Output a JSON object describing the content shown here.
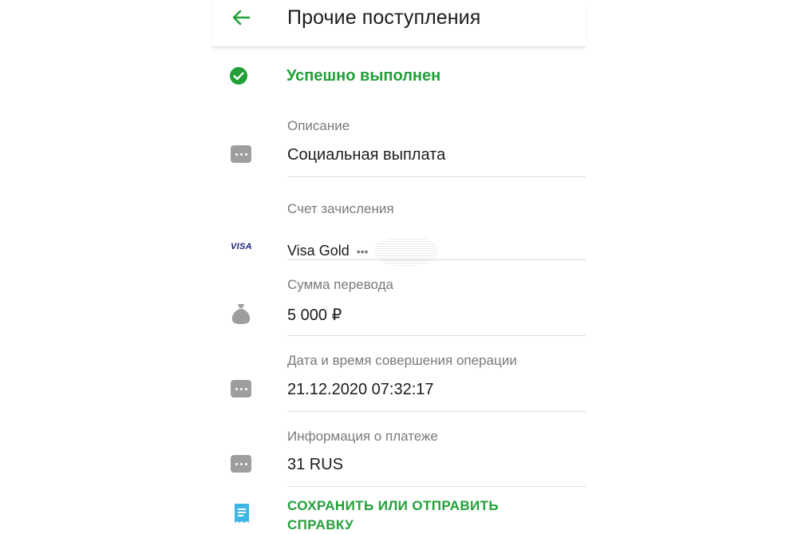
{
  "header": {
    "title": "Прочие поступления",
    "back_icon": "arrow-left-icon"
  },
  "status": {
    "text": "Успешно выполнен",
    "icon": "check-circle-icon",
    "color": "#21a038"
  },
  "details": {
    "description": {
      "label": "Описание",
      "value": "Социальная выплата",
      "icon": "dots-icon"
    },
    "account": {
      "label": "Счет зачисления",
      "value": "Visa Gold",
      "suffix": "•••",
      "icon_text": "VISA"
    },
    "amount": {
      "label": "Сумма перевода",
      "value": "5 000 ₽",
      "icon": "money-bag-icon"
    },
    "datetime": {
      "label": "Дата и время совершения операции",
      "value": "21.12.2020 07:32:17",
      "icon": "dots-icon"
    },
    "payment_info": {
      "label": "Информация о платеже",
      "value": "31 RUS",
      "icon": "dots-icon"
    }
  },
  "action": {
    "label": "СОХРАНИТЬ ИЛИ ОТПРАВИТЬ СПРАВКУ",
    "icon": "receipt-icon"
  },
  "colors": {
    "accent": "#21a038",
    "icon_gray": "#9e9e9e",
    "receipt_blue": "#3fb6e6",
    "visa_blue": "#1a1f71"
  }
}
